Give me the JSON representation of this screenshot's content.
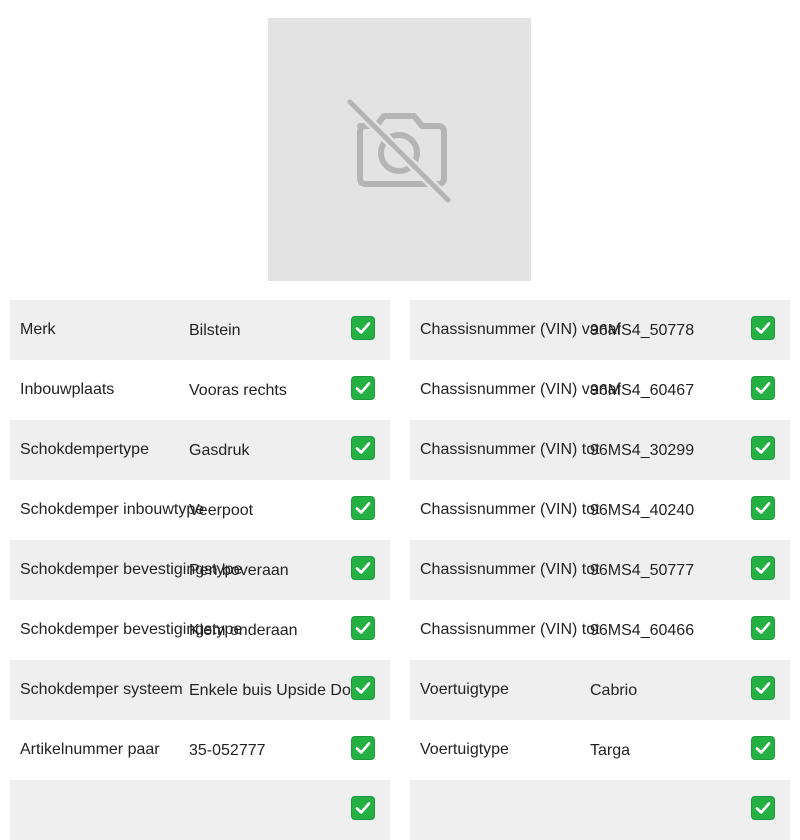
{
  "product_image": {
    "icon": "camera-off-icon",
    "background_color": "#e3e3e3"
  },
  "check_icon": "check-mark-icon",
  "accent_color": "#25b043",
  "left_specs": [
    {
      "label": "Merk",
      "value": "Bilstein"
    },
    {
      "label": "Inbouwplaats",
      "value": "Vooras rechts"
    },
    {
      "label": "Schokdempertype",
      "value": "Gasdruk"
    },
    {
      "label": "Schokdemper inbouwtype",
      "value": "Veerpoot"
    },
    {
      "label": "Schokdemper bevestigingstype",
      "value": "Pen boveraan"
    },
    {
      "label": "Schokdemper bevestigingstype",
      "value": "Klem onderaan"
    },
    {
      "label": "Schokdemper systeem",
      "value": "Enkele buis Upside Down"
    },
    {
      "label": "Artikelnummer paar",
      "value": "35-052777"
    },
    {
      "label": "",
      "value": ""
    }
  ],
  "right_specs": [
    {
      "label": "Chassisnummer (VIN) vanaf",
      "value": "96MS4_50778"
    },
    {
      "label": "Chassisnummer (VIN) vanaf",
      "value": "96MS4_60467"
    },
    {
      "label": "Chassisnummer (VIN) tot",
      "value": "96MS4_30299"
    },
    {
      "label": "Chassisnummer (VIN) tot",
      "value": "96MS4_40240"
    },
    {
      "label": "Chassisnummer (VIN) tot",
      "value": "96MS4_50777"
    },
    {
      "label": "Chassisnummer (VIN) tot",
      "value": "96MS4_60466"
    },
    {
      "label": "Voertuigtype",
      "value": "Cabrio"
    },
    {
      "label": "Voertuigtype",
      "value": "Targa"
    },
    {
      "label": "",
      "value": ""
    }
  ]
}
